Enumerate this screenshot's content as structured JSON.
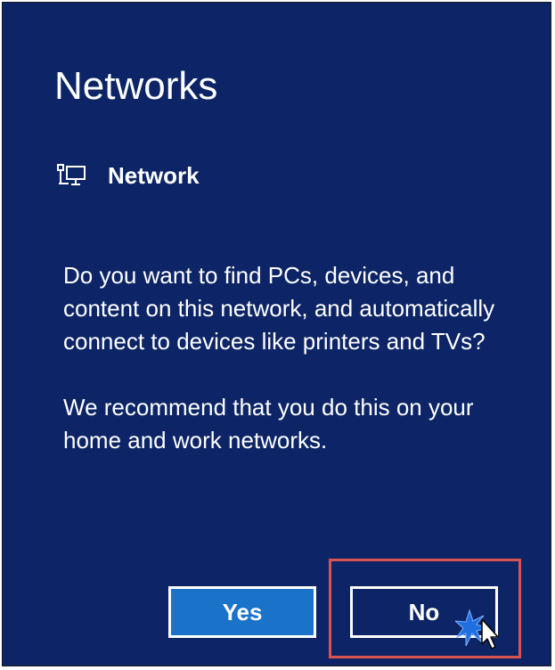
{
  "dialog": {
    "title": "Networks",
    "network": {
      "icon": "wired-network-icon",
      "name": "Network"
    },
    "message": [
      "Do you want to find PCs, devices, and content on this network, and automatically connect to devices like printers and TVs?",
      "We recommend that you do this on your home and work networks."
    ],
    "buttons": {
      "yes_label": "Yes",
      "no_label": "No"
    }
  },
  "colors": {
    "panel_background": "#0d2566",
    "yes_button": "#1a72c9",
    "highlight": "#d9534f",
    "text": "#ffffff"
  }
}
